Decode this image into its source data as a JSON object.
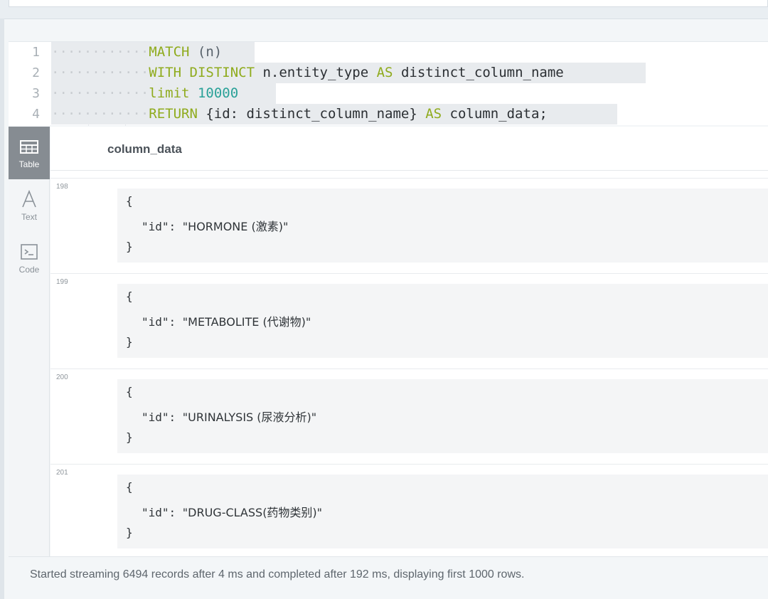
{
  "editor": {
    "line_numbers": [
      "1",
      "2",
      "3",
      "4"
    ],
    "lines": [
      [
        {
          "t": "MATCH",
          "c": "kw"
        },
        {
          "t": " (n)",
          "c": "punc"
        }
      ],
      [
        {
          "t": "WITH",
          "c": "kw"
        },
        {
          "t": " ",
          "c": ""
        },
        {
          "t": "DISTINCT",
          "c": "kw"
        },
        {
          "t": " n.entity_type ",
          "c": ""
        },
        {
          "t": "AS",
          "c": "kw"
        },
        {
          "t": " distinct_column_name",
          "c": ""
        }
      ],
      [
        {
          "t": "limit",
          "c": "kw"
        },
        {
          "t": " ",
          "c": ""
        },
        {
          "t": "10000",
          "c": "num"
        }
      ],
      [
        {
          "t": "RETURN",
          "c": "kw"
        },
        {
          "t": " {id: distinct_column_name} ",
          "c": ""
        },
        {
          "t": "AS",
          "c": "kw"
        },
        {
          "t": " column_data;",
          "c": ""
        }
      ]
    ]
  },
  "sidebar": {
    "items": [
      {
        "label": "Table",
        "icon": "table-icon",
        "active": true
      },
      {
        "label": "Text",
        "icon": "text-icon",
        "active": false
      },
      {
        "label": "Code",
        "icon": "code-icon",
        "active": false
      }
    ]
  },
  "results": {
    "column_header": "column_data",
    "rows": [
      {
        "index": "198",
        "open": "{",
        "key": "\"id\"",
        "value": "\"HORMONE (激素)\"",
        "close": "}"
      },
      {
        "index": "199",
        "open": "{",
        "key": "\"id\"",
        "value": "\"METABOLITE (代谢物)\"",
        "close": "}"
      },
      {
        "index": "200",
        "open": "{",
        "key": "\"id\"",
        "value": "\"URINALYSIS (尿液分析)\"",
        "close": "}"
      },
      {
        "index": "201",
        "open": "{",
        "key": "\"id\"",
        "value": "\"DRUG-CLASS(药物类别)\"",
        "close": "}"
      }
    ]
  },
  "footer": {
    "status": "Started streaming 6494 records after 4 ms and completed after 192 ms, displaying first 1000 rows."
  }
}
